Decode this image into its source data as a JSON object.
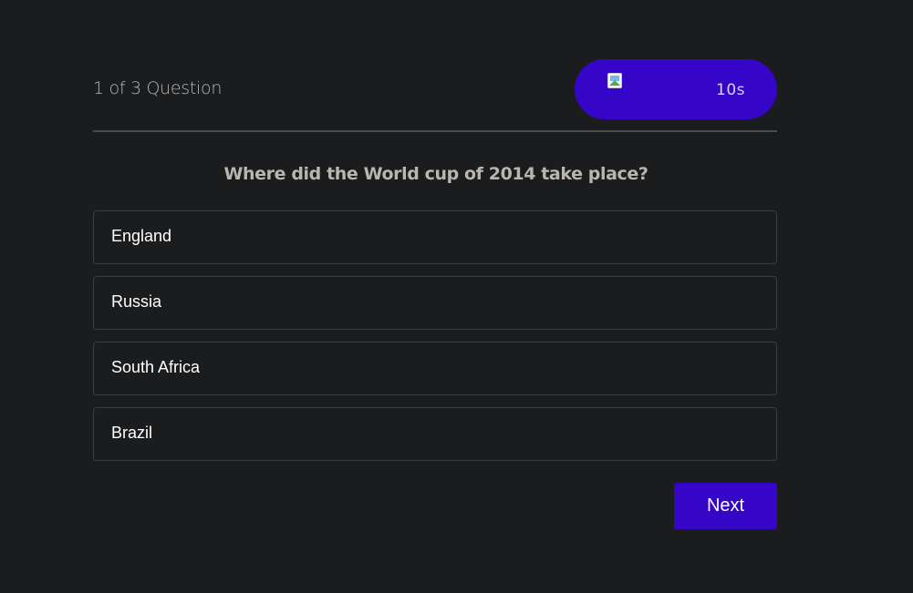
{
  "header": {
    "counter": "1 of 3 Question",
    "timer": {
      "icon": "broken-image-icon",
      "text": "10s"
    }
  },
  "question": "Where did the World cup of 2014 take place?",
  "options": [
    {
      "label": "England"
    },
    {
      "label": "Russia"
    },
    {
      "label": "South Africa"
    },
    {
      "label": "Brazil"
    }
  ],
  "footer": {
    "next_label": "Next"
  },
  "colors": {
    "background": "#1b1c1e",
    "accent": "#3505c8",
    "option_border": "#3d3e42"
  }
}
